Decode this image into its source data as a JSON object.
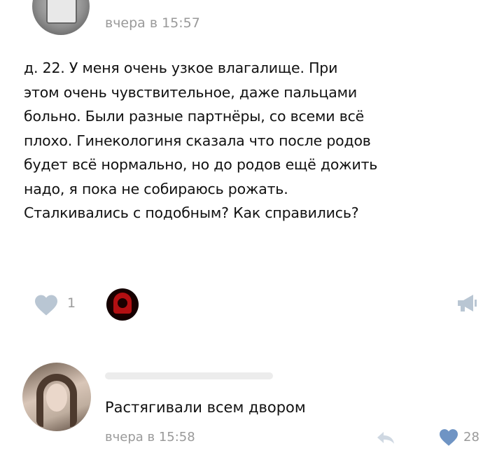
{
  "post": {
    "time": "вчера в 15:57",
    "text_lines": [
      "д. 22. У меня очень узкое влагалище. При",
      "этом очень чувствительное, даже пальцами",
      "больно. Были разные партнёры, со всеми всё",
      "плохо. Гинекологиня сказала что после родов",
      "будет всё нормально, но до родов ещё дожить",
      "надо, я пока не собираюсь рожать.",
      "Сталкивались с подобным? Как справились?"
    ],
    "likes_count": "1"
  },
  "comment": {
    "text": "Растягивали всем двором",
    "time": "вчера в 15:58",
    "likes_count": "28"
  },
  "colors": {
    "muted_text": "#9a9a9a",
    "icon_gray": "#b9c6d3",
    "heart_blue": "#6f94c4"
  },
  "icons": [
    "heart-icon",
    "megaphone-icon",
    "reply-arrow-icon"
  ]
}
